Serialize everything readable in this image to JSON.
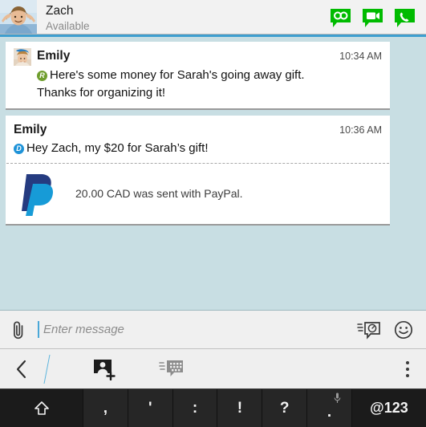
{
  "header": {
    "contact_name": "Zach",
    "status": "Available",
    "avatar_alt": "photo of smiling man with hands behind head",
    "actions": [
      {
        "name": "bbm-chat-button",
        "icon": "bbm-glasses-icon"
      },
      {
        "name": "video-call-button",
        "icon": "video-camera-icon"
      },
      {
        "name": "voice-call-button",
        "icon": "phone-icon"
      }
    ],
    "accent_color": "#3e9fd0",
    "action_color": "#00bb00"
  },
  "chat": {
    "background_color": "#c8dee3",
    "messages": [
      {
        "sender": "Emily",
        "time": "10:34 AM",
        "status_icon": "R",
        "status_label": "read",
        "status_color": "#6f9e2e",
        "line1": "Here's some money for Sarah's going away gift.",
        "line2": "Thanks for organizing it!",
        "has_avatar": true
      },
      {
        "sender": "Emily",
        "time": "10:36 AM",
        "status_icon": "D",
        "status_label": "delivered",
        "status_color": "#1f93d8",
        "line1": "Hey Zach, my $20 for Sarah’s gift!",
        "line2": "",
        "has_avatar": false
      }
    ],
    "paypal": {
      "text": "20.00 CAD was sent with PayPal.",
      "logo_name": "paypal-logo",
      "color_dark": "#253b80",
      "color_light": "#179bd7"
    }
  },
  "input": {
    "placeholder": "Enter message",
    "value": "",
    "attach_icon": "paperclip-icon",
    "timed_icon": "timed-message-icon",
    "emoji_icon": "smiley-icon"
  },
  "navbar": {
    "back_icon": "back-chevron-icon",
    "add_participant_icon": "add-participant-icon",
    "ping_icon": "bbm-ping-icon",
    "overflow_icon": "overflow-menu-icon"
  },
  "keyboard": {
    "keys": [
      {
        "label": "⇧",
        "name": "shift-key",
        "type": "shift"
      },
      {
        "label": ",",
        "name": "comma-key",
        "type": "punc"
      },
      {
        "label": "'",
        "name": "apostrophe-key",
        "type": "punc"
      },
      {
        "label": ":",
        "name": "colon-key",
        "type": "punc"
      },
      {
        "label": "!",
        "name": "exclamation-key",
        "type": "punc"
      },
      {
        "label": "?",
        "name": "question-key",
        "type": "punc"
      },
      {
        "label": ".",
        "name": "period-key",
        "type": "punc-mic"
      },
      {
        "label": "@123",
        "name": "symbols-key",
        "type": "at123"
      }
    ]
  }
}
